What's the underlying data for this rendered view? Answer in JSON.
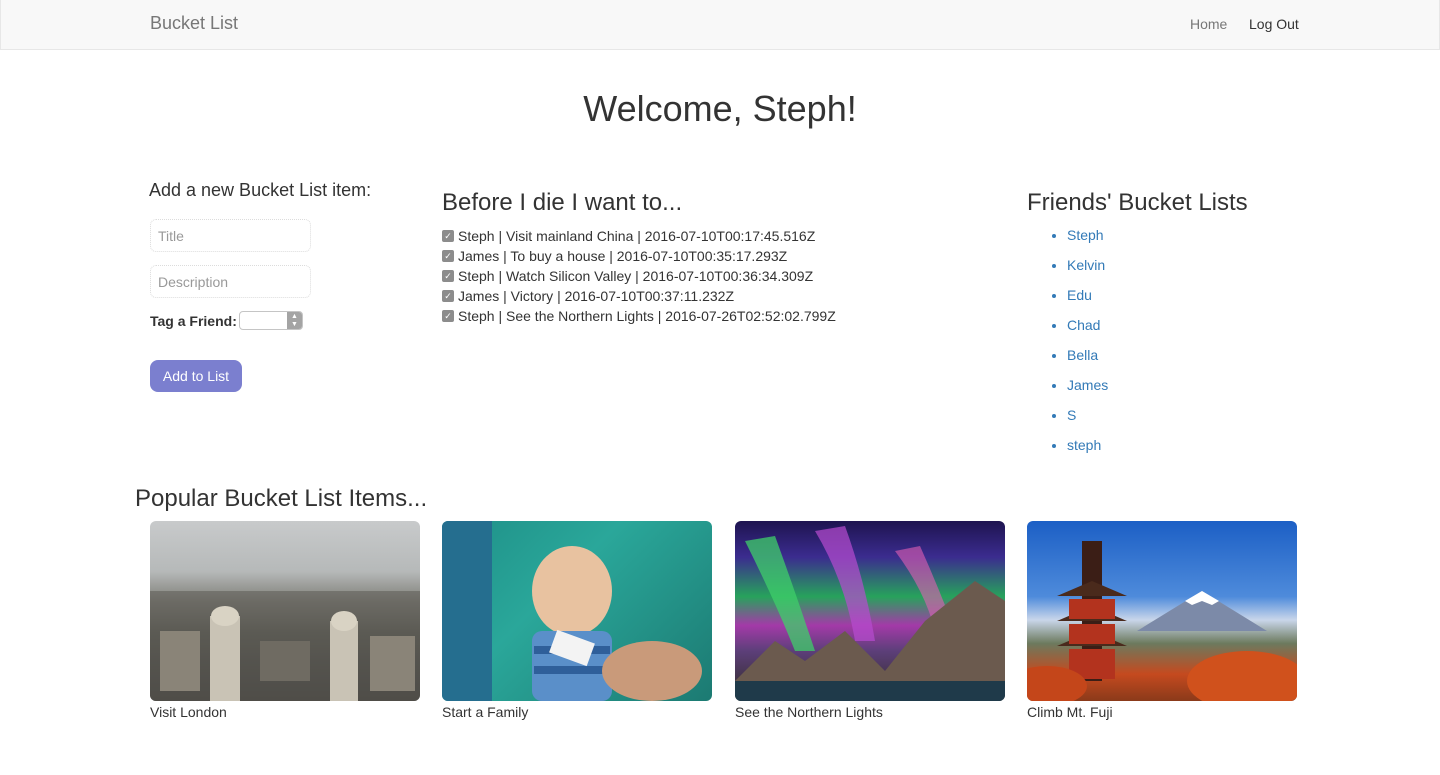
{
  "nav": {
    "brand": "Bucket List",
    "home": "Home",
    "logout": "Log Out"
  },
  "welcome": "Welcome, Steph!",
  "add_form": {
    "heading": "Add a new Bucket List item:",
    "title_placeholder": "Title",
    "description_placeholder": "Description",
    "tag_label": "Tag a Friend:",
    "button": "Add to List"
  },
  "bucket": {
    "heading": "Before I die I want to...",
    "items": [
      "Steph | Visit mainland China | 2016-07-10T00:17:45.516Z",
      "James | To buy a house | 2016-07-10T00:35:17.293Z",
      "Steph | Watch Silicon Valley | 2016-07-10T00:36:34.309Z",
      "James | Victory | 2016-07-10T00:37:11.232Z",
      "Steph | See the Northern Lights | 2016-07-26T02:52:02.799Z"
    ]
  },
  "friends": {
    "heading": "Friends' Bucket Lists",
    "names": [
      "Steph",
      "Kelvin",
      "Edu",
      "Chad",
      "Bella",
      "James",
      "S",
      "steph"
    ]
  },
  "popular": {
    "heading": "Popular Bucket List Items...",
    "cards": [
      {
        "caption": "Visit London"
      },
      {
        "caption": "Start a Family"
      },
      {
        "caption": "See the Northern Lights"
      },
      {
        "caption": "Climb Mt. Fuji"
      }
    ]
  },
  "colors": {
    "button": "#7b7fcf",
    "link": "#337ab7",
    "navbar": "#f8f8f8"
  }
}
